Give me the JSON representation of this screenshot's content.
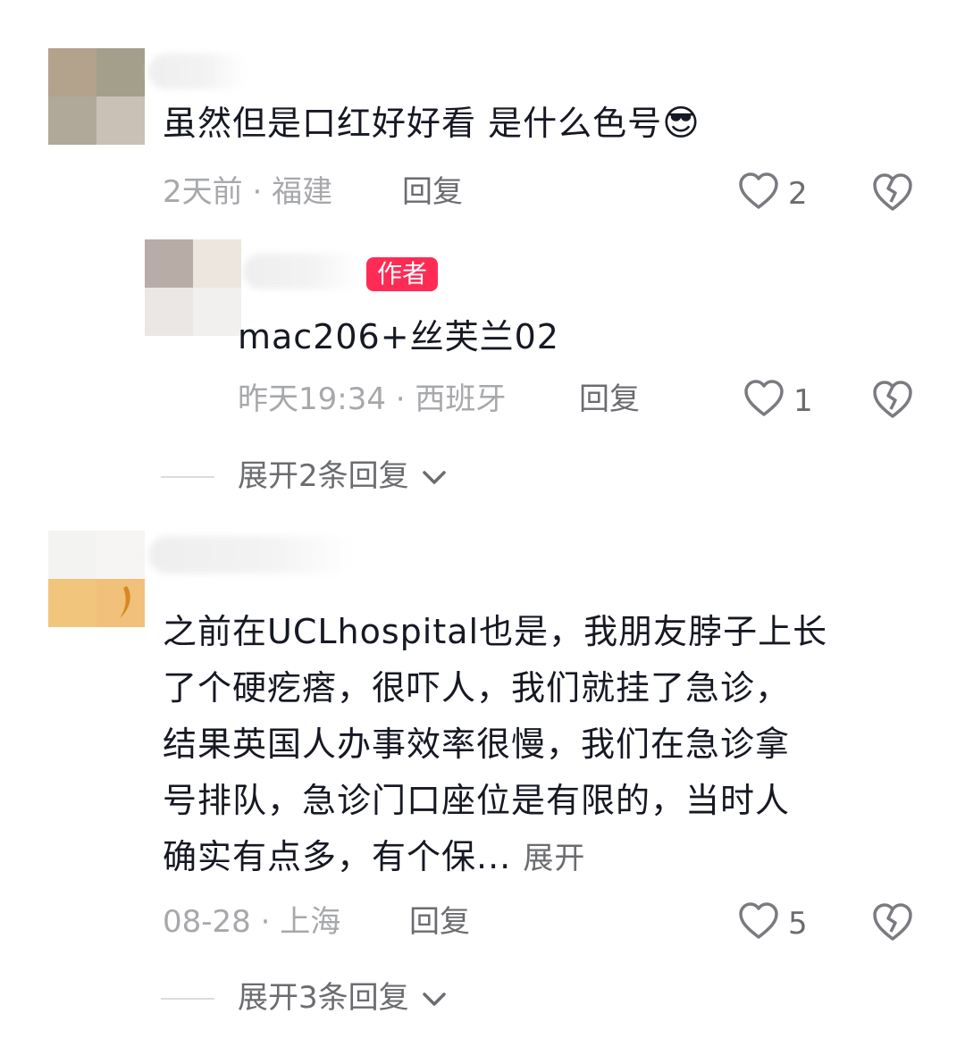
{
  "comments": [
    {
      "text": "虽然但是口红好好看 是什么色号",
      "emoji": "😎",
      "time": "2天前",
      "location": "福建",
      "reply_label": "回复",
      "likes": "2",
      "reply": {
        "badge": "作者",
        "text": "mac206+丝芙兰02",
        "time": "昨天19:34",
        "location": "西班牙",
        "reply_label": "回复",
        "likes": "1"
      },
      "expand_label": "展开2条回复"
    },
    {
      "text_lines": [
        "之前在UCLhospital也是，我朋友脖子上长",
        "了个硬疙瘩，很吓人，我们就挂了急诊，",
        "结果英国人办事效率很慢，我们在急诊拿",
        "号排队，急诊门口座位是有限的，当时人",
        "确实有点多，有个保..."
      ],
      "more_label": "展开",
      "time": "08-28",
      "location": "上海",
      "reply_label": "回复",
      "likes": "5",
      "expand_label": "展开3条回复"
    }
  ],
  "separator": "·",
  "colors": {
    "accent": "#fe2c55",
    "text": "#161823",
    "meta": "#a7a8ab"
  }
}
